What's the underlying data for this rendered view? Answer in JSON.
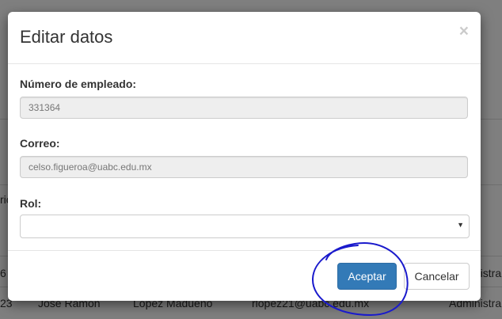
{
  "modal": {
    "title": "Editar datos",
    "close_symbol": "×",
    "fields": {
      "employee_number": {
        "label": "Número de empleado:",
        "value": "331364"
      },
      "email": {
        "label": "Correo:",
        "value": "celso.figueroa@uabc.edu.mx"
      },
      "role": {
        "label": "Rol:",
        "value": ""
      }
    },
    "buttons": {
      "accept": "Aceptar",
      "cancel": "Cancelar"
    }
  },
  "background_table": {
    "partial_cells": [
      "ric",
      "6",
      "23",
      "José Ramón",
      "López Madueño",
      "rlopez21@uabc.edu.mx",
      "Administra",
      "Administra"
    ]
  },
  "colors": {
    "primary": "#337ab7",
    "annotation": "#1a1acc"
  }
}
